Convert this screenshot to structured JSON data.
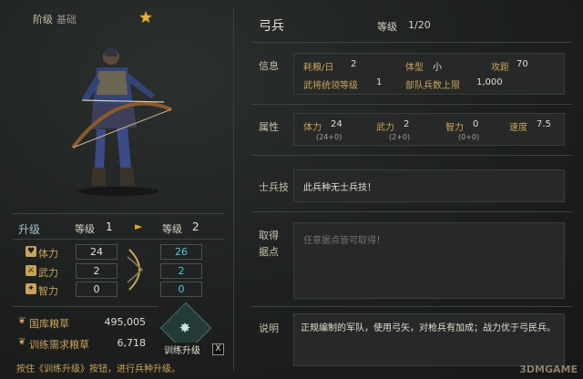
{
  "left": {
    "tier": {
      "label": "阶级",
      "value": "基础"
    },
    "upgrade": {
      "title": "升级",
      "from_label": "等级",
      "from_value": "1",
      "to_label": "等级",
      "to_value": "2"
    },
    "stats": [
      {
        "icon": "heart-icon",
        "name": "体力",
        "current": "24",
        "next": "26"
      },
      {
        "icon": "sword-icon",
        "name": "武力",
        "current": "2",
        "next": "2"
      },
      {
        "icon": "brain-icon",
        "name": "智力",
        "current": "0",
        "next": "0"
      }
    ],
    "resources": [
      {
        "icon": "grain-icon",
        "name": "国库粮草",
        "value": "495,005"
      },
      {
        "icon": "grain-icon",
        "name": "训练需求粮草",
        "value": "6,718"
      }
    ],
    "train_button_label": "训练升级",
    "train_key": "X",
    "hint": "按住《训练升级》按钮，进行兵种升级。"
  },
  "right": {
    "unit_name": "弓兵",
    "rank_label": "等级",
    "rank_value": "1/20",
    "info": {
      "label": "信息",
      "grain_label": "耗粮/日",
      "grain_value": "2",
      "size_label": "体型",
      "size_value": "小",
      "attack_label": "攻距",
      "attack_value": "70",
      "general_label": "武将统领等级",
      "general_value": "1",
      "troop_label": "部队兵数上限",
      "troop_value": "1,000"
    },
    "attributes": {
      "label": "属性",
      "items": [
        {
          "name": "体力",
          "value": "24",
          "sub": "(24+0)"
        },
        {
          "name": "武力",
          "value": "2",
          "sub": "(2+0)"
        },
        {
          "name": "智力",
          "value": "0",
          "sub": "(0+0)"
        },
        {
          "name": "速度",
          "value": "7.5",
          "sub": ""
        }
      ]
    },
    "skill": {
      "label": "士兵技",
      "text": "此兵种无士兵技！"
    },
    "acquire": {
      "label_1": "取得",
      "label_2": "据点",
      "placeholder": "任意据点皆可取得！"
    },
    "description": {
      "label": "说明",
      "text": "正规编制的军队，使用弓矢，对枪兵有加成；战力优于弓民兵。"
    }
  },
  "watermark": "3DMGAME"
}
